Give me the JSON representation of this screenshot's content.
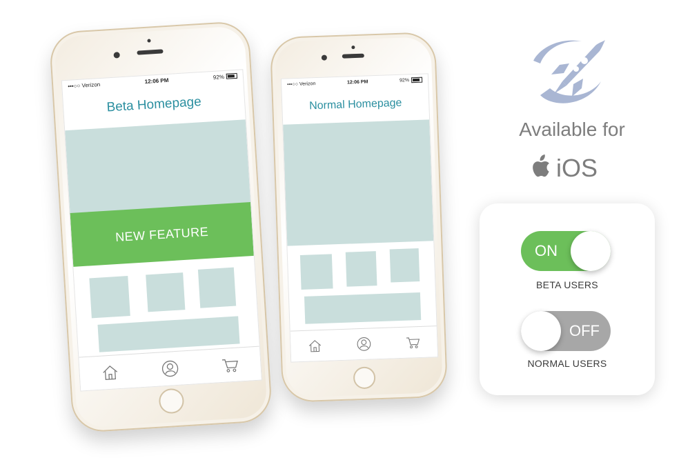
{
  "phones": {
    "beta": {
      "status": {
        "carrier": "•••○○ Verizon",
        "time": "12:06 PM",
        "battery": "92%"
      },
      "title": "Beta Homepage",
      "feature_banner": "NEW FEATURE"
    },
    "normal": {
      "status": {
        "carrier": "•••○○ Verizon",
        "time": "12:06 PM",
        "battery": "92%"
      },
      "title": "Normal Homepage"
    },
    "tabbar_icons": [
      "home-icon",
      "profile-icon",
      "cart-icon"
    ]
  },
  "branding": {
    "logo_icon": "rocket-icon",
    "available_text": "Available for",
    "platform_icon": "apple-icon",
    "platform_text": "iOS"
  },
  "toggles": {
    "beta": {
      "state_label": "ON",
      "caption": "BETA USERS",
      "color": "#6cbf5a",
      "on": true
    },
    "normal": {
      "state_label": "OFF",
      "caption": "NORMAL USERS",
      "color": "#a7a7a7",
      "on": false
    }
  },
  "colors": {
    "accent_green": "#6cbf5a",
    "title_teal": "#2b8fa0",
    "placeholder": "#c9dedc",
    "logo_blue": "#a9b6d3"
  }
}
